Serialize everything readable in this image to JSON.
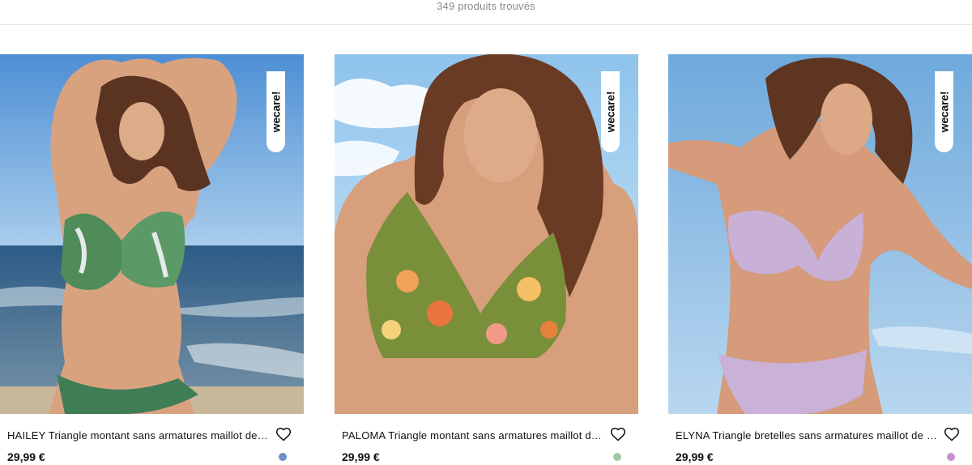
{
  "results": {
    "count_text": "349 produits trouvés"
  },
  "badge": {
    "label": "wecare!"
  },
  "products": [
    {
      "name": "HAILEY Triangle montant sans armatures maillot de bain",
      "price": "29,99 €",
      "swatch_color": "#6b8fc6"
    },
    {
      "name": "PALOMA Triangle montant sans armatures maillot de bain",
      "price": "29,99 €",
      "swatch_color": "#9fc9a0"
    },
    {
      "name": "ELYNA Triangle bretelles sans armatures maillot de bain",
      "price": "29,99 €",
      "swatch_color": "#c98fd1"
    }
  ],
  "icons": {
    "favorite": "heart-outline-icon"
  }
}
